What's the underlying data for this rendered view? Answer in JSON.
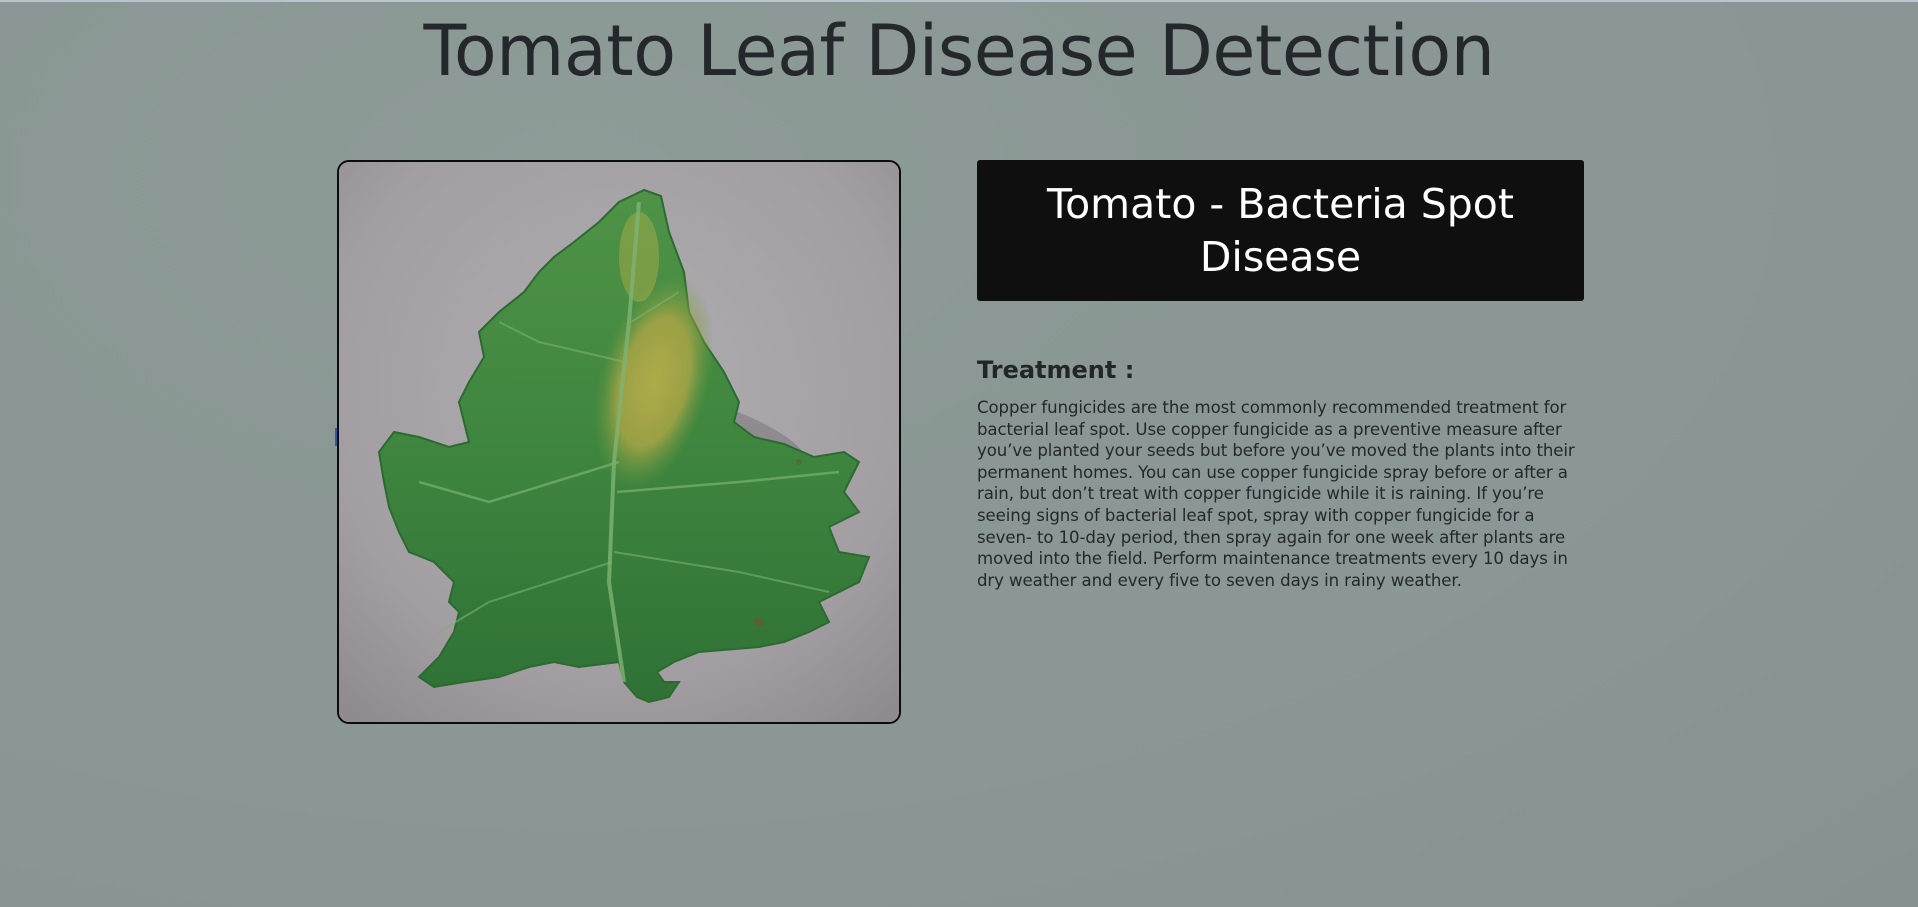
{
  "page": {
    "title": "Tomato Leaf Disease Detection"
  },
  "prediction": {
    "label": "Tomato - Bacteria Spot Disease",
    "image_alt": "tomato leaf photo"
  },
  "treatment": {
    "heading": "Treatment :",
    "text": "Copper fungicides are the most commonly recommended treatment for bacterial leaf spot. Use copper fungicide as a preventive measure after you’ve planted your seeds but before you’ve moved the plants into their permanent homes. You can use copper fungicide spray before or after a rain, but don’t treat with copper fungicide while it is raining. If you’re seeing signs of bacterial leaf spot, spray with copper fungicide for a seven- to 10-day period, then spray again for one week after plants are moved into the field. Perform maintenance treatments every 10 days in dry weather and every five to seven days in rainy weather."
  },
  "colors": {
    "background": "#8a9794",
    "result_box": "#0f0f0f",
    "result_text": "#ffffff",
    "leaf_green": "#3f8a3e",
    "leaf_yellow": "#b4a540"
  }
}
